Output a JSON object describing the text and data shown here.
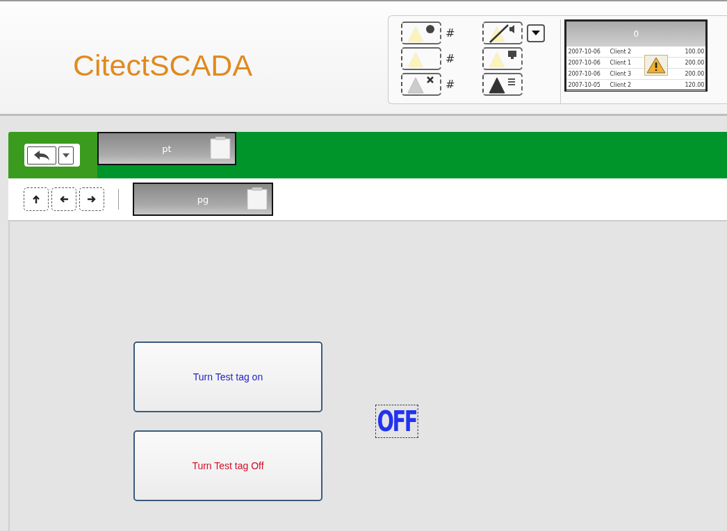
{
  "logo": "CitectSCADA",
  "alarm_counters": [
    {
      "count": "#",
      "kind": "acknowledged"
    },
    {
      "count": "#",
      "kind": "active"
    },
    {
      "count": "#",
      "kind": "cleared"
    }
  ],
  "alarm_tools": [
    {
      "kind": "silence"
    },
    {
      "kind": "display"
    },
    {
      "kind": "list"
    }
  ],
  "alarm_preview": {
    "header": "0",
    "rows": [
      {
        "date": "2007-10-06",
        "client": "Client 2",
        "value": "100.00"
      },
      {
        "date": "2007-10-06",
        "client": "Client 1",
        "value": "200.00"
      },
      {
        "date": "2007-10-06",
        "client": "Client 3",
        "value": "200.00"
      },
      {
        "date": "2007-10-05",
        "client": "Client 2",
        "value": "120.00"
      }
    ]
  },
  "page_tab": {
    "label": "pt"
  },
  "nav_buttons": [
    {
      "kind": "up"
    },
    {
      "kind": "back"
    },
    {
      "kind": "forward"
    }
  ],
  "page_field": {
    "label": "pg"
  },
  "buttons": [
    {
      "label": "Turn Test tag on",
      "color": "#2323c8"
    },
    {
      "label": "Turn Test tag Off",
      "color": "#d0102a"
    }
  ],
  "tag_state": "OFF"
}
